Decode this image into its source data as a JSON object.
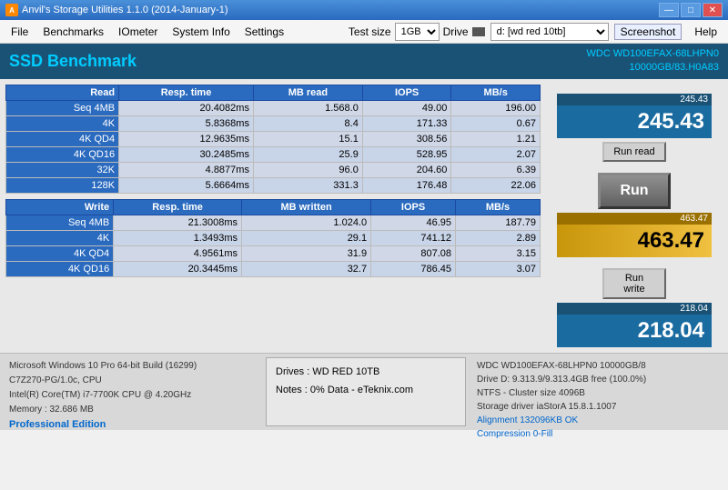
{
  "titleBar": {
    "title": "Anvil's Storage Utilities 1.1.0 (2014-January-1)",
    "iconLabel": "A",
    "controls": [
      "—",
      "□",
      "✕"
    ]
  },
  "menuBar": {
    "items": [
      "File",
      "Benchmarks",
      "IOmeter",
      "System Info",
      "Settings"
    ],
    "testSizeLabel": "Test size",
    "testSizeValue": "1GB",
    "driveLabel": "Drive",
    "driveValue": "d: [wd red 10tb]",
    "screenshotLabel": "Screenshot",
    "helpLabel": "Help"
  },
  "ssdHeader": {
    "title": "SSD Benchmark",
    "driveInfo1": "WDC WD100EFAX-68LHPN0",
    "driveInfo2": "10000GB/83.H0A83"
  },
  "readTable": {
    "headers": [
      "Read",
      "Resp. time",
      "MB read",
      "IOPS",
      "MB/s"
    ],
    "rows": [
      [
        "Seq 4MB",
        "20.4082ms",
        "1.568.0",
        "49.00",
        "196.00"
      ],
      [
        "4K",
        "5.8368ms",
        "8.4",
        "171.33",
        "0.67"
      ],
      [
        "4K QD4",
        "12.9635ms",
        "15.1",
        "308.56",
        "1.21"
      ],
      [
        "4K QD16",
        "30.2485ms",
        "25.9",
        "528.95",
        "2.07"
      ],
      [
        "32K",
        "4.8877ms",
        "96.0",
        "204.60",
        "6.39"
      ],
      [
        "128K",
        "5.6664ms",
        "331.3",
        "176.48",
        "22.06"
      ]
    ]
  },
  "writeTable": {
    "headers": [
      "Write",
      "Resp. time",
      "MB written",
      "IOPS",
      "MB/s"
    ],
    "rows": [
      [
        "Seq 4MB",
        "21.3008ms",
        "1.024.0",
        "46.95",
        "187.79"
      ],
      [
        "4K",
        "1.3493ms",
        "29.1",
        "741.12",
        "2.89"
      ],
      [
        "4K QD4",
        "4.9561ms",
        "31.9",
        "807.08",
        "3.15"
      ],
      [
        "4K QD16",
        "20.3445ms",
        "32.7",
        "786.45",
        "3.07"
      ]
    ]
  },
  "scores": {
    "runReadLabel": "Run read",
    "runWriteLabel": "Run write",
    "runLabel": "Run",
    "readScoreSmall": "245.43",
    "readScore": "245.43",
    "totalScoreSmall": "463.47",
    "totalScore": "463.47",
    "writeScoreSmall": "218.04",
    "writeScore": "218.04"
  },
  "bottomBar": {
    "sysInfo": [
      "Microsoft Windows 10 Pro 64-bit Build (16299)",
      "C7Z270-PG/1.0c, CPU",
      "Intel(R) Core(TM) i7-7700K CPU @ 4.20GHz",
      "Memory : 32.686 MB"
    ],
    "proEdition": "Professional Edition",
    "drives": "Drives : WD RED 10TB",
    "notes": "Notes : 0% Data - eTeknix.com",
    "rightInfo": [
      "WDC WD100EFAX-68LHPN0 10000GB/8",
      "Drive D: 9.313.9/9.313.4GB free (100.0%)",
      "NTFS - Cluster size 4096B",
      "Storage driver  iaStorA 15.8.1.1007",
      "",
      "Alignment 132096KB OK",
      "Compression 0-Fill"
    ]
  }
}
